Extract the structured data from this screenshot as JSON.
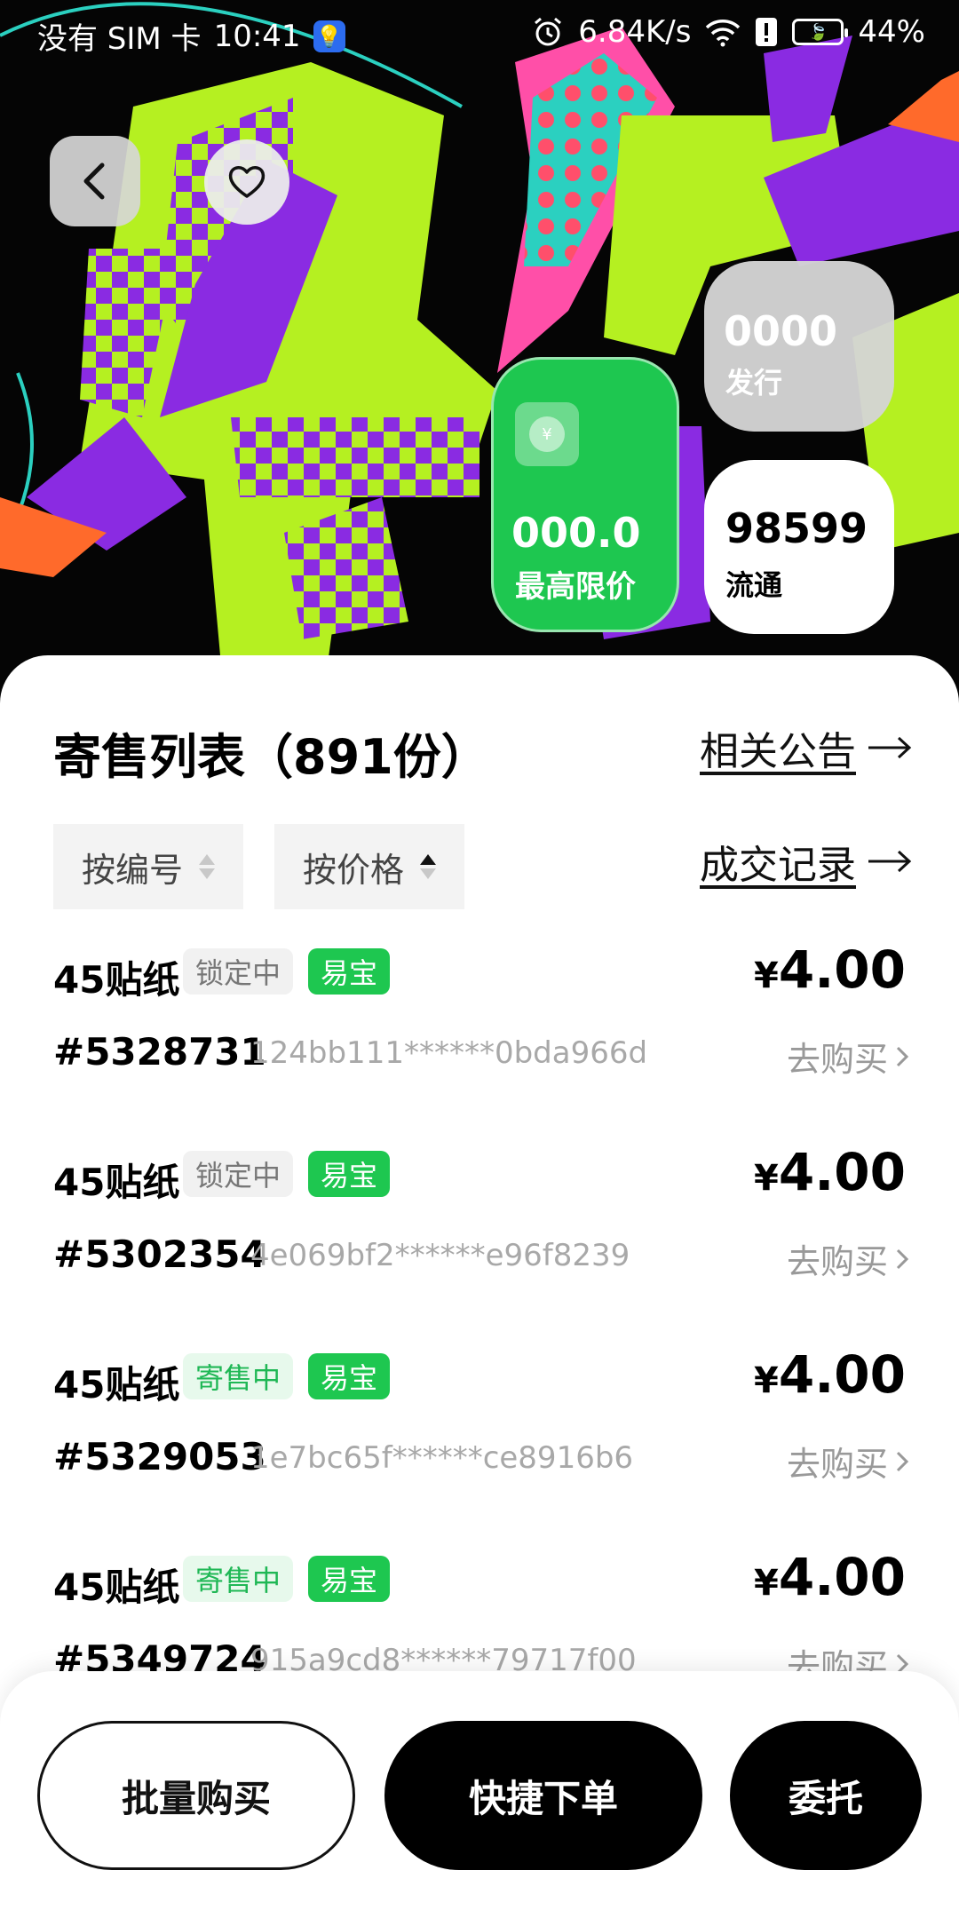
{
  "status_bar": {
    "carrier": "没有 SIM 卡",
    "time": "10:41",
    "net_speed": "6.84K/s",
    "battery": "44%"
  },
  "stats": {
    "max_price_value": "000.0",
    "max_price_label": "最高限价",
    "issued_value": "0000",
    "issued_label": "发行",
    "circulation_value": "98599",
    "circulation_label": "流通"
  },
  "list": {
    "title": "寄售列表（891份）",
    "notice_link": "相关公告",
    "record_link": "成交记录",
    "sort_by_no": "按编号",
    "sort_by_price": "按价格",
    "items": [
      {
        "name": "45贴纸",
        "status": "锁定中",
        "platform": "易宝",
        "currency": "¥",
        "price": "4.00",
        "serial": "#5328731",
        "hash": "124bb111******0bda966d",
        "buy": "去购买"
      },
      {
        "name": "45贴纸",
        "status": "锁定中",
        "platform": "易宝",
        "currency": "¥",
        "price": "4.00",
        "serial": "#5302354",
        "hash": "4e069bf2******e96f8239",
        "buy": "去购买"
      },
      {
        "name": "45贴纸",
        "status": "寄售中",
        "platform": "易宝",
        "currency": "¥",
        "price": "4.00",
        "serial": "#5329053",
        "hash": "1e7bc65f******ce8916b6",
        "buy": "去购买"
      },
      {
        "name": "45贴纸",
        "status": "寄售中",
        "platform": "易宝",
        "currency": "¥",
        "price": "4.00",
        "serial": "#5349724",
        "hash": "915a9cd8******79717f00",
        "buy": "去购买"
      }
    ]
  },
  "actions": {
    "batch_buy": "批量购买",
    "quick_order": "快捷下单",
    "entrust": "委托"
  },
  "colors": {
    "accent_green": "#1ec750",
    "on_sale_text": "#1fb755",
    "hero_lime": "#b5f021",
    "hero_purple": "#8a2be2"
  },
  "icons": [
    "back-icon",
    "heart-icon",
    "alarm-icon",
    "wifi-icon",
    "battery-icon",
    "coin-icon",
    "arrow-right-icon",
    "chevron-right-icon",
    "sort-arrows-icon"
  ]
}
